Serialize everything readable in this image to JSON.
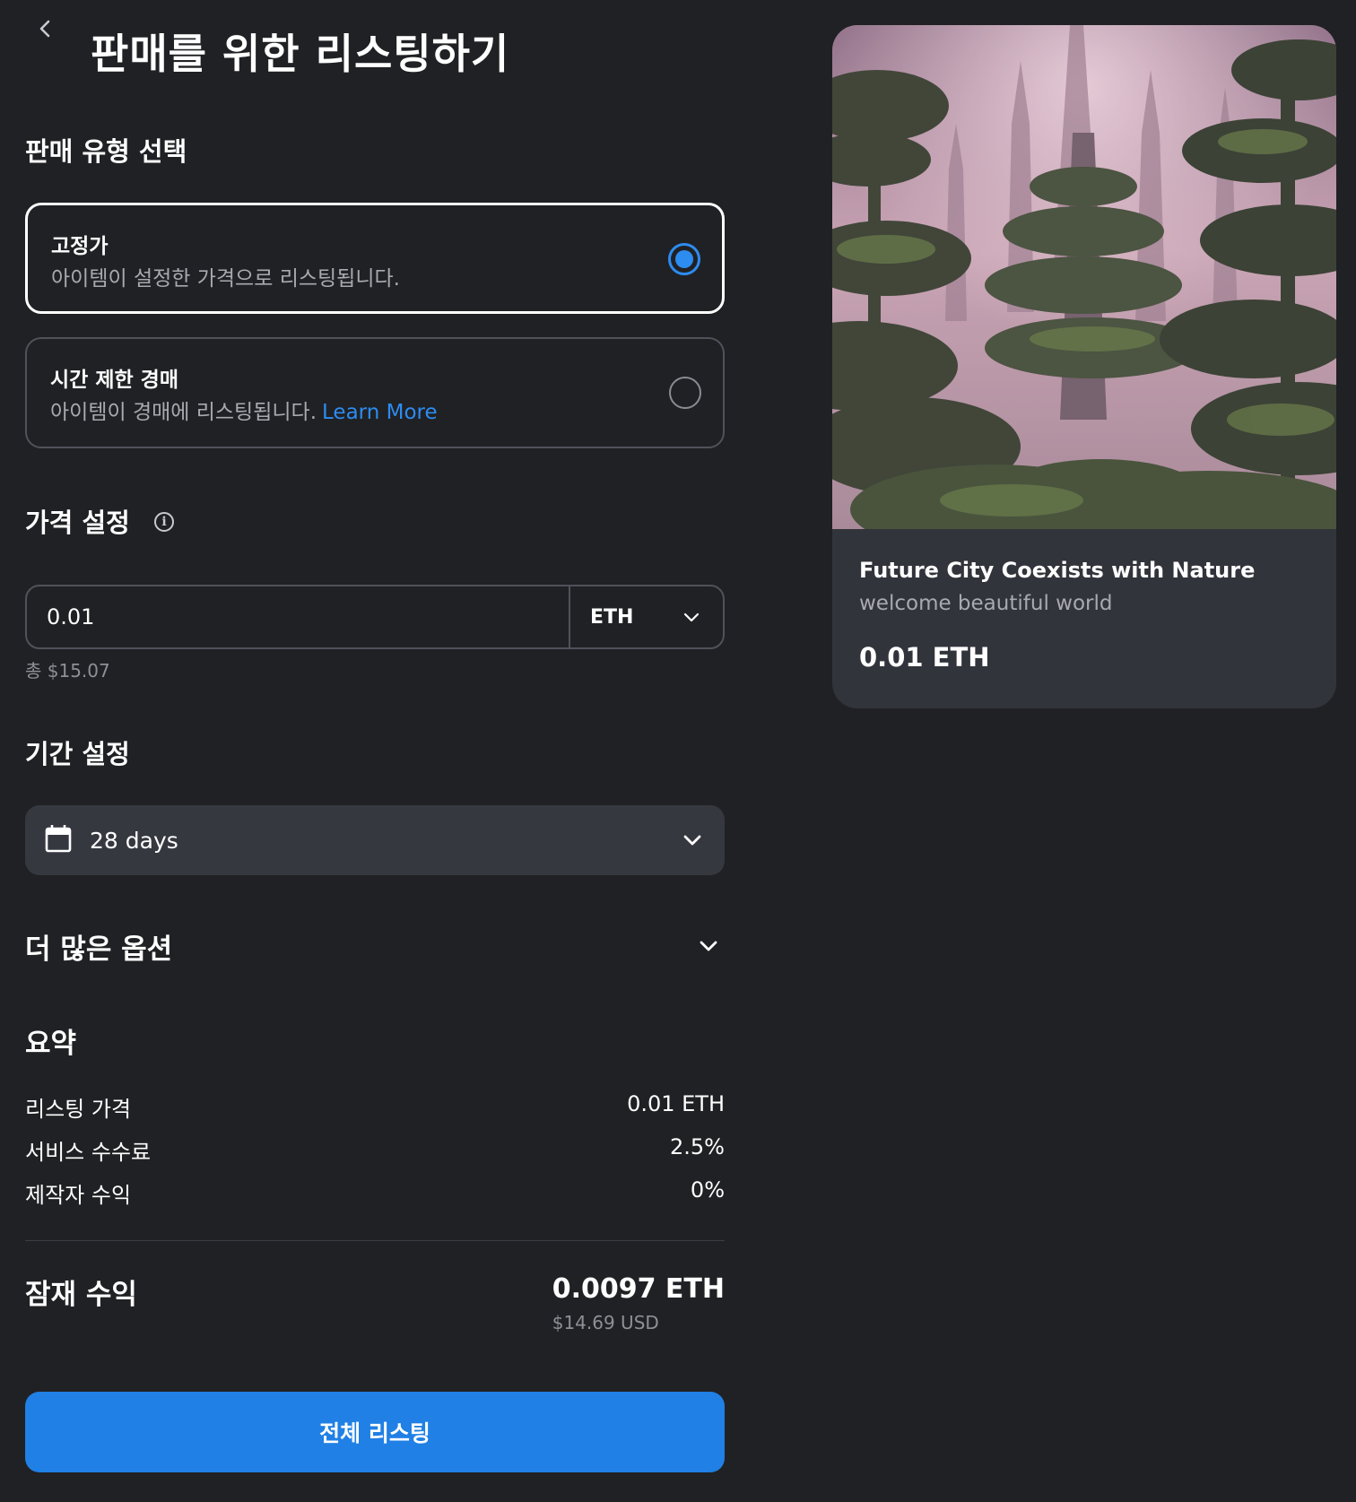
{
  "header": {
    "title": "판매를 위한 리스팅하기"
  },
  "sale_type": {
    "heading": "판매 유형 선택",
    "options": [
      {
        "title": "고정가",
        "description": "아이템이 설정한 가격으로 리스팅됩니다.",
        "selected": true
      },
      {
        "title": "시간 제한 경매",
        "description": "아이템이 경매에 리스팅됩니다.",
        "link": "Learn More",
        "selected": false
      }
    ]
  },
  "price": {
    "heading": "가격 설정",
    "value": "0.01",
    "currency": "ETH",
    "total": "총 $15.07"
  },
  "duration": {
    "heading": "기간 설정",
    "value": "28 days"
  },
  "more_options": {
    "label": "더 많은 옵션"
  },
  "summary": {
    "heading": "요약",
    "rows": [
      {
        "label": "리스팅 가격",
        "value": "0.01 ETH"
      },
      {
        "label": "서비스 수수료",
        "value": "2.5%"
      },
      {
        "label": "제작자 수익",
        "value": "0%"
      }
    ],
    "potential_earnings": {
      "label": "잠재 수익",
      "eth": "0.0097 ETH",
      "usd": "$14.69 USD"
    }
  },
  "cta": {
    "label": "전체 리스팅"
  },
  "preview": {
    "title": "Future City Coexists with Nature",
    "subtitle": "welcome beautiful world",
    "price": "0.01 ETH"
  },
  "colors": {
    "background": "#202124",
    "accent": "#2080e5",
    "link": "#2d8cf0",
    "card": "#32343b"
  }
}
